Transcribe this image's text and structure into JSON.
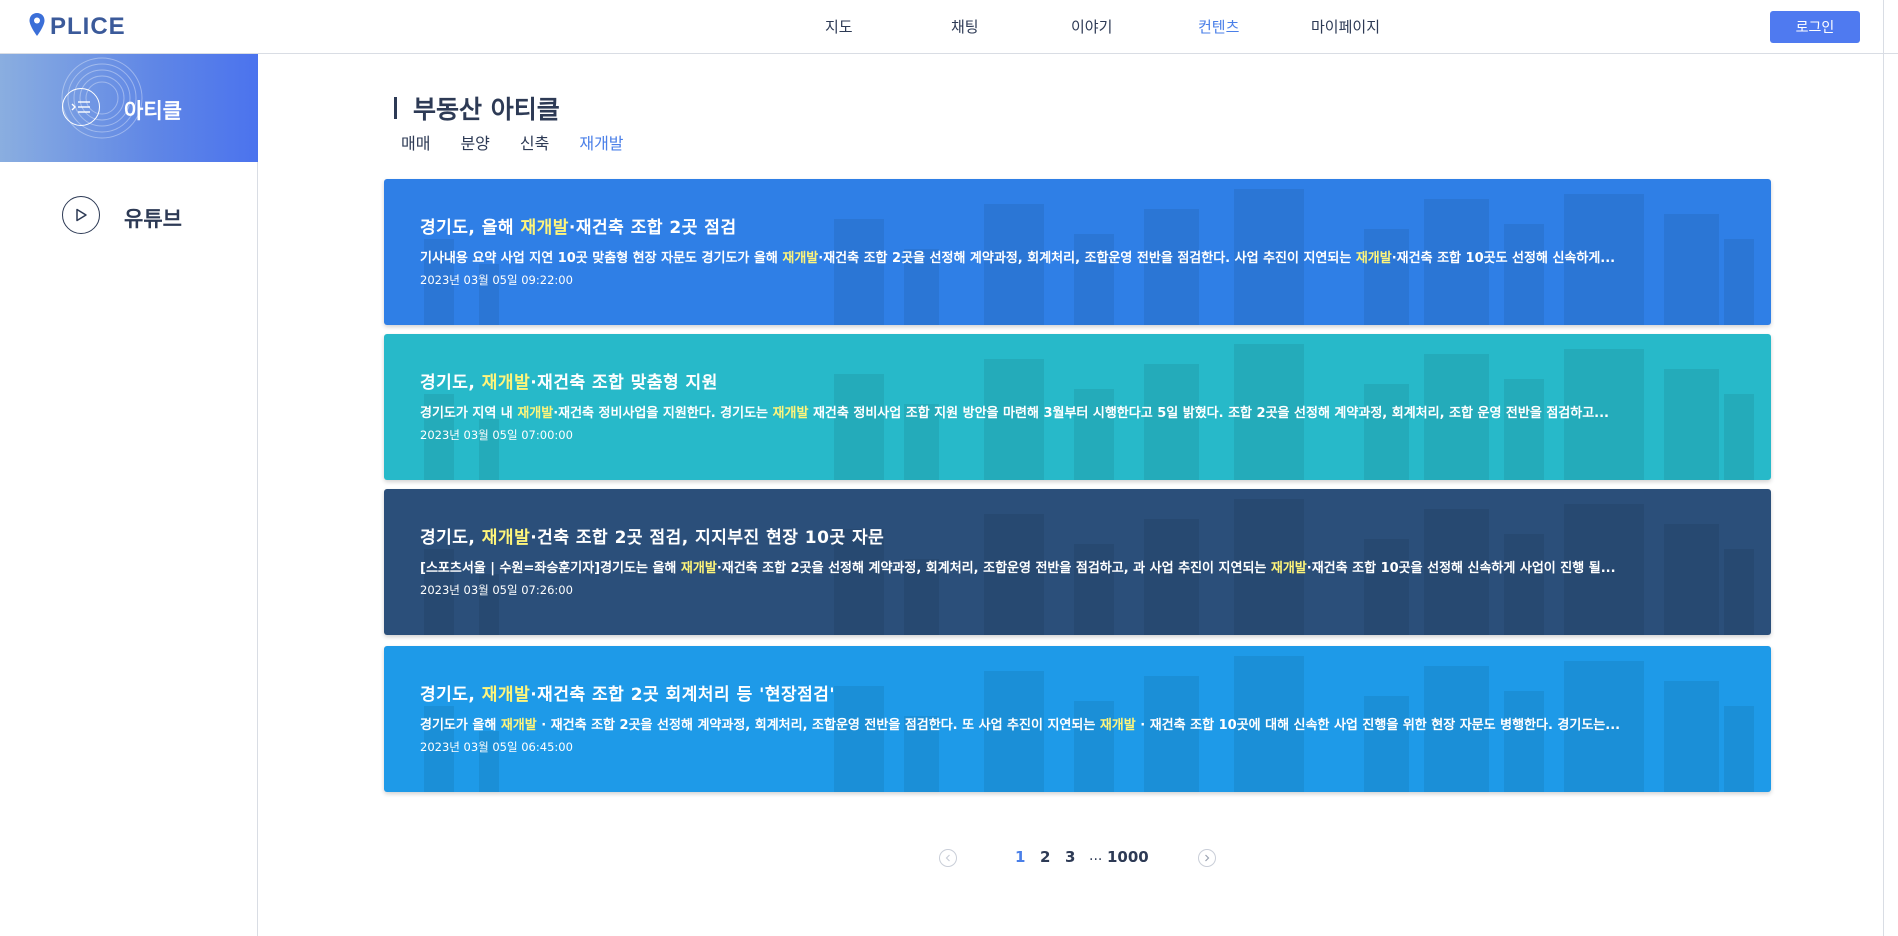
{
  "brand": {
    "name": "PLICE",
    "logo_icon": "map-pin-icon"
  },
  "nav": {
    "items": [
      {
        "label": "지도"
      },
      {
        "label": "채팅"
      },
      {
        "label": "이야기"
      },
      {
        "label": "컨텐츠"
      },
      {
        "label": "마이페이지"
      }
    ],
    "active": "컨텐츠",
    "login_label": "로그인"
  },
  "sidebar": {
    "items": [
      {
        "label": "아티클",
        "icon": "article-list-icon",
        "active": true
      },
      {
        "label": "유튜브",
        "icon": "play-icon",
        "active": false
      }
    ]
  },
  "main": {
    "title": "부동산 아티클",
    "tabs": [
      {
        "label": "매매"
      },
      {
        "label": "분양"
      },
      {
        "label": "신축"
      },
      {
        "label": "재개발"
      }
    ],
    "active_tab": "재개발",
    "highlight_keyword": "재개발",
    "articles": [
      {
        "title": "경기도, 올해 재개발·재건축 조합 2곳 점검",
        "summary": "기사내용 요약 사업 지연 10곳 맞춤형 현장 자문도 경기도가 올해 재개발·재건축 조합 2곳을 선정해 계약과정, 회계처리, 조합운영 전반을 점검한다. 사업 추진이 지연되는 재개발·재건축 조합 10곳도 선정해 신속하게...",
        "date": "2023년 03월 05일 09:22:00",
        "color": "#2f7fe6"
      },
      {
        "title": "경기도, 재개발·재건축 조합 맞춤형 지원",
        "summary": "경기도가 지역 내 재개발·재건축 정비사업을 지원한다. 경기도는 재개발 재건축 정비사업 조합 지원 방안을 마련해 3월부터 시행한다고 5일 밝혔다. 조합 2곳을 선정해 계약과정, 회계처리, 조합 운영 전반을 점검하고...",
        "date": "2023년 03월 05일 07:00:00",
        "color": "#27b9c9"
      },
      {
        "title": "경기도, 재개발·건축 조합 2곳 점검, 지지부진 현장 10곳 자문",
        "summary": "[스포츠서울 | 수원=좌승훈기자]경기도는 올해 재개발·재건축 조합 2곳을 선정해 계약과정, 회계처리, 조합운영 전반을 점검하고, 과 사업 추진이 지연되는 재개발·재건축 조합 10곳을 선정해 신속하게 사업이 진행 될...",
        "date": "2023년 03월 05일 07:26:00",
        "color": "#2b4f7a"
      },
      {
        "title": "경기도, 재개발·재건축 조합 2곳 회계처리 등 '현장점검'",
        "summary": "경기도가 올해 재개발 · 재건축 조합 2곳을 선정해 계약과정, 회계처리, 조합운영 전반을 점검한다. 또 사업 추진이 지연되는 재개발 · 재건축 조합 10곳에 대해 신속한 사업 진행을 위한 현장 자문도 병행한다. 경기도는...",
        "date": "2023년 03월 05일 06:45:00",
        "color": "#1e9ae8"
      }
    ]
  },
  "pagination": {
    "pages": [
      "1",
      "2",
      "3"
    ],
    "ellipsis": "...",
    "last": "1000",
    "current": "1",
    "prev_icon": "chevron-left-icon",
    "next_icon": "chevron-right-icon"
  },
  "colors": {
    "accent": "#4a7fe8",
    "text": "#2d3a55",
    "highlight": "#fff57a"
  }
}
